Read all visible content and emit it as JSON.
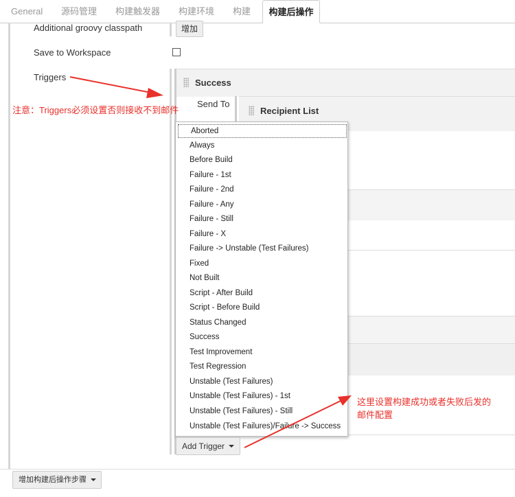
{
  "tabs": [
    {
      "label": "General"
    },
    {
      "label": "源码管理"
    },
    {
      "label": "构建触发器"
    },
    {
      "label": "构建环境"
    },
    {
      "label": "构建"
    },
    {
      "label": "构建后操作"
    }
  ],
  "form": {
    "groovy_label": "Additional groovy classpath",
    "groovy_add": "增加",
    "save_label": "Save to Workspace",
    "triggers_label": "Triggers"
  },
  "success_panel": {
    "title": "Success",
    "send_to": "Send To",
    "recipient_title": "Recipient List"
  },
  "dropdown": {
    "items": [
      "Aborted",
      "Always",
      "Before Build",
      "Failure - 1st",
      "Failure - 2nd",
      "Failure - Any",
      "Failure - Still",
      "Failure - X",
      "Failure -> Unstable (Test Failures)",
      "Fixed",
      "Not Built",
      "Script - After Build",
      "Script - Before Build",
      "Status Changed",
      "Success",
      "Test Improvement",
      "Test Regression",
      "Unstable (Test Failures)",
      "Unstable (Test Failures) - 1st",
      "Unstable (Test Failures) - Still",
      "Unstable (Test Failures)/Failure -> Success"
    ]
  },
  "add_trigger": "Add Trigger",
  "add_post_build": "增加构建后操作步骤",
  "annotations": {
    "triggers_note": "注意：Triggers必须设置否则接收不到邮件",
    "config_note_1": "这里设置构建成功或者失败后发的",
    "config_note_2": "邮件配置"
  },
  "colors": {
    "annotation_red": "#e8312b"
  }
}
